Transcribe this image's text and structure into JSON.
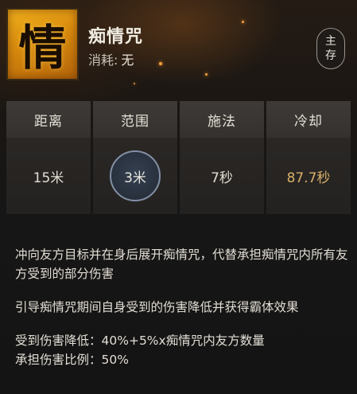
{
  "skill": {
    "icon_char": "情",
    "icon_name": "qing-glyph-icon",
    "name": "痴情咒",
    "cost_label": "消耗:",
    "cost_value": "无",
    "badge_line1": "主",
    "badge_line2": "存"
  },
  "stats": [
    {
      "label": "距离",
      "value": "15米"
    },
    {
      "label": "范围",
      "value": "3米"
    },
    {
      "label": "施法",
      "value": "7秒"
    },
    {
      "label": "冷却",
      "value": "87.7秒"
    }
  ],
  "description": {
    "para1": "冲向友方目标并在身后展开痴情咒，代替承担痴情咒内所有友方受到的部分伤害",
    "para2": "引导痴情咒期间自身受到的伤害降低并获得霸体效果",
    "line3": "受到伤害降低：40%+5%x痴情咒内友方数量",
    "line4": "承担伤害比例：50%"
  },
  "colors": {
    "icon_bg": "#e19a12",
    "cooldown_text": "#d9b06a",
    "range_ring": "#8290a6",
    "header_cell": "#3a3734",
    "body_cell": "#272422"
  }
}
